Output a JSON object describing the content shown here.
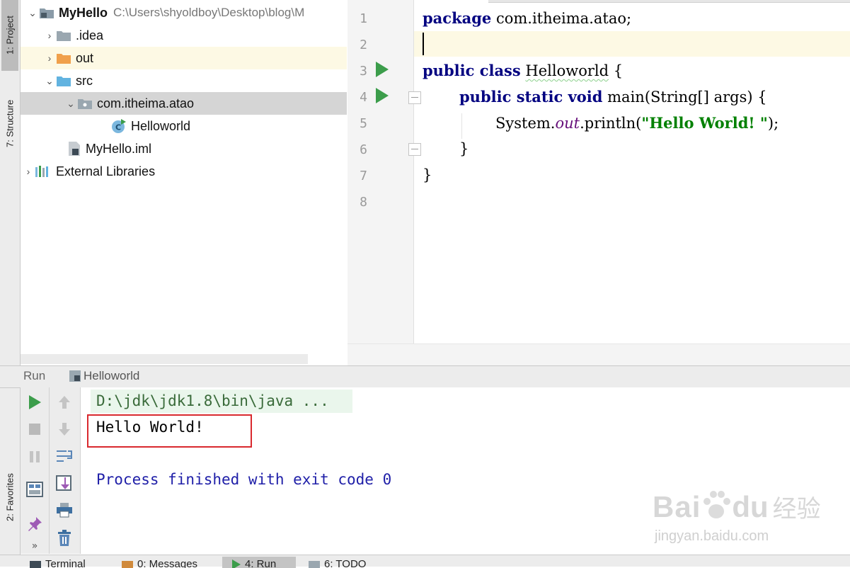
{
  "sidebar": {
    "tabs": [
      {
        "label": "1: Project"
      },
      {
        "label": "7: Structure"
      },
      {
        "label": "2: Favorites"
      }
    ]
  },
  "project": {
    "root_name": "MyHello",
    "root_path": "C:\\Users\\shyoldboy\\Desktop\\blog\\M",
    "items": [
      {
        "label": ".idea"
      },
      {
        "label": "out"
      },
      {
        "label": "src"
      },
      {
        "label": "com.itheima.atao"
      },
      {
        "label": "Helloworld"
      },
      {
        "label": "MyHello.iml"
      },
      {
        "label": "External Libraries"
      }
    ]
  },
  "editor": {
    "line_numbers": [
      "1",
      "2",
      "3",
      "4",
      "5",
      "6",
      "7",
      "8"
    ],
    "code": {
      "l1_kw": "package",
      "l1_rest": " com.itheima.atao;",
      "l3_kw": "public class",
      "l3_name": "Helloworld",
      "l3_rest": " {",
      "l4_kw": "public static void",
      "l4_rest": " main(String[] args) {",
      "l5_pre": "System.",
      "l5_field": "out",
      "l5_mid": ".println(",
      "l5_str": "\"Hello World! \"",
      "l5_end": ");",
      "l6": "}",
      "l7": "}"
    }
  },
  "run_panel": {
    "title": "Run",
    "config_name": "Helloworld",
    "console": {
      "command": "D:\\jdk\\jdk1.8\\bin\\java ...",
      "output": "Hello World!",
      "exit_message": "Process finished with exit code 0"
    }
  },
  "bottom_tabs": [
    {
      "label": "Terminal"
    },
    {
      "label": "0: Messages"
    },
    {
      "label": "4: Run"
    },
    {
      "label": "6: TODO"
    }
  ],
  "watermark": {
    "brand": "Bai",
    "brand2": "du",
    "cn": "经验",
    "url": "jingyan.baidu.com"
  },
  "colors": {
    "keyword": "#000080",
    "string": "#008000",
    "run_green": "#3c9d4b",
    "highlight_box": "#d9292e"
  }
}
